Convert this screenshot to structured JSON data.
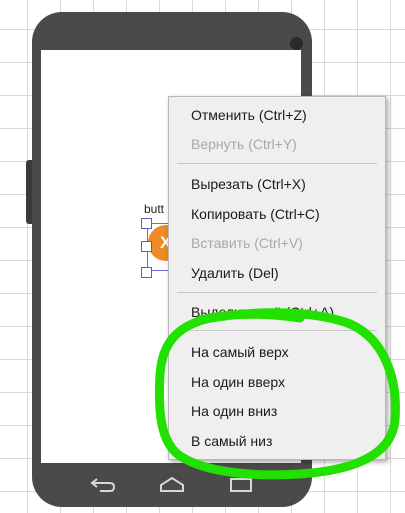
{
  "canvas": {
    "component": {
      "label": "butt",
      "glyph": "X",
      "color": "#f08a24"
    }
  },
  "context_menu": {
    "items": [
      {
        "label": "Отменить (Ctrl+Z)",
        "enabled": true
      },
      {
        "label": "Вернуть (Ctrl+Y)",
        "enabled": false
      },
      {
        "label": "Вырезать (Ctrl+X)",
        "enabled": true
      },
      {
        "label": "Копировать (Ctrl+C)",
        "enabled": true
      },
      {
        "label": "Вставить (Ctrl+V)",
        "enabled": false
      },
      {
        "label": "Удалить (Del)",
        "enabled": true
      },
      {
        "label": "Выделить всё (Ctrl+A)",
        "enabled": true
      },
      {
        "label": "На самый верх",
        "enabled": true
      },
      {
        "label": "На один вверх",
        "enabled": true
      },
      {
        "label": "На один вниз",
        "enabled": true
      },
      {
        "label": "В самый низ",
        "enabled": true
      }
    ]
  },
  "phone": {
    "nav_icons": [
      "back-icon",
      "home-icon",
      "recents-icon"
    ]
  },
  "annotation": {
    "color": "#22e000"
  }
}
